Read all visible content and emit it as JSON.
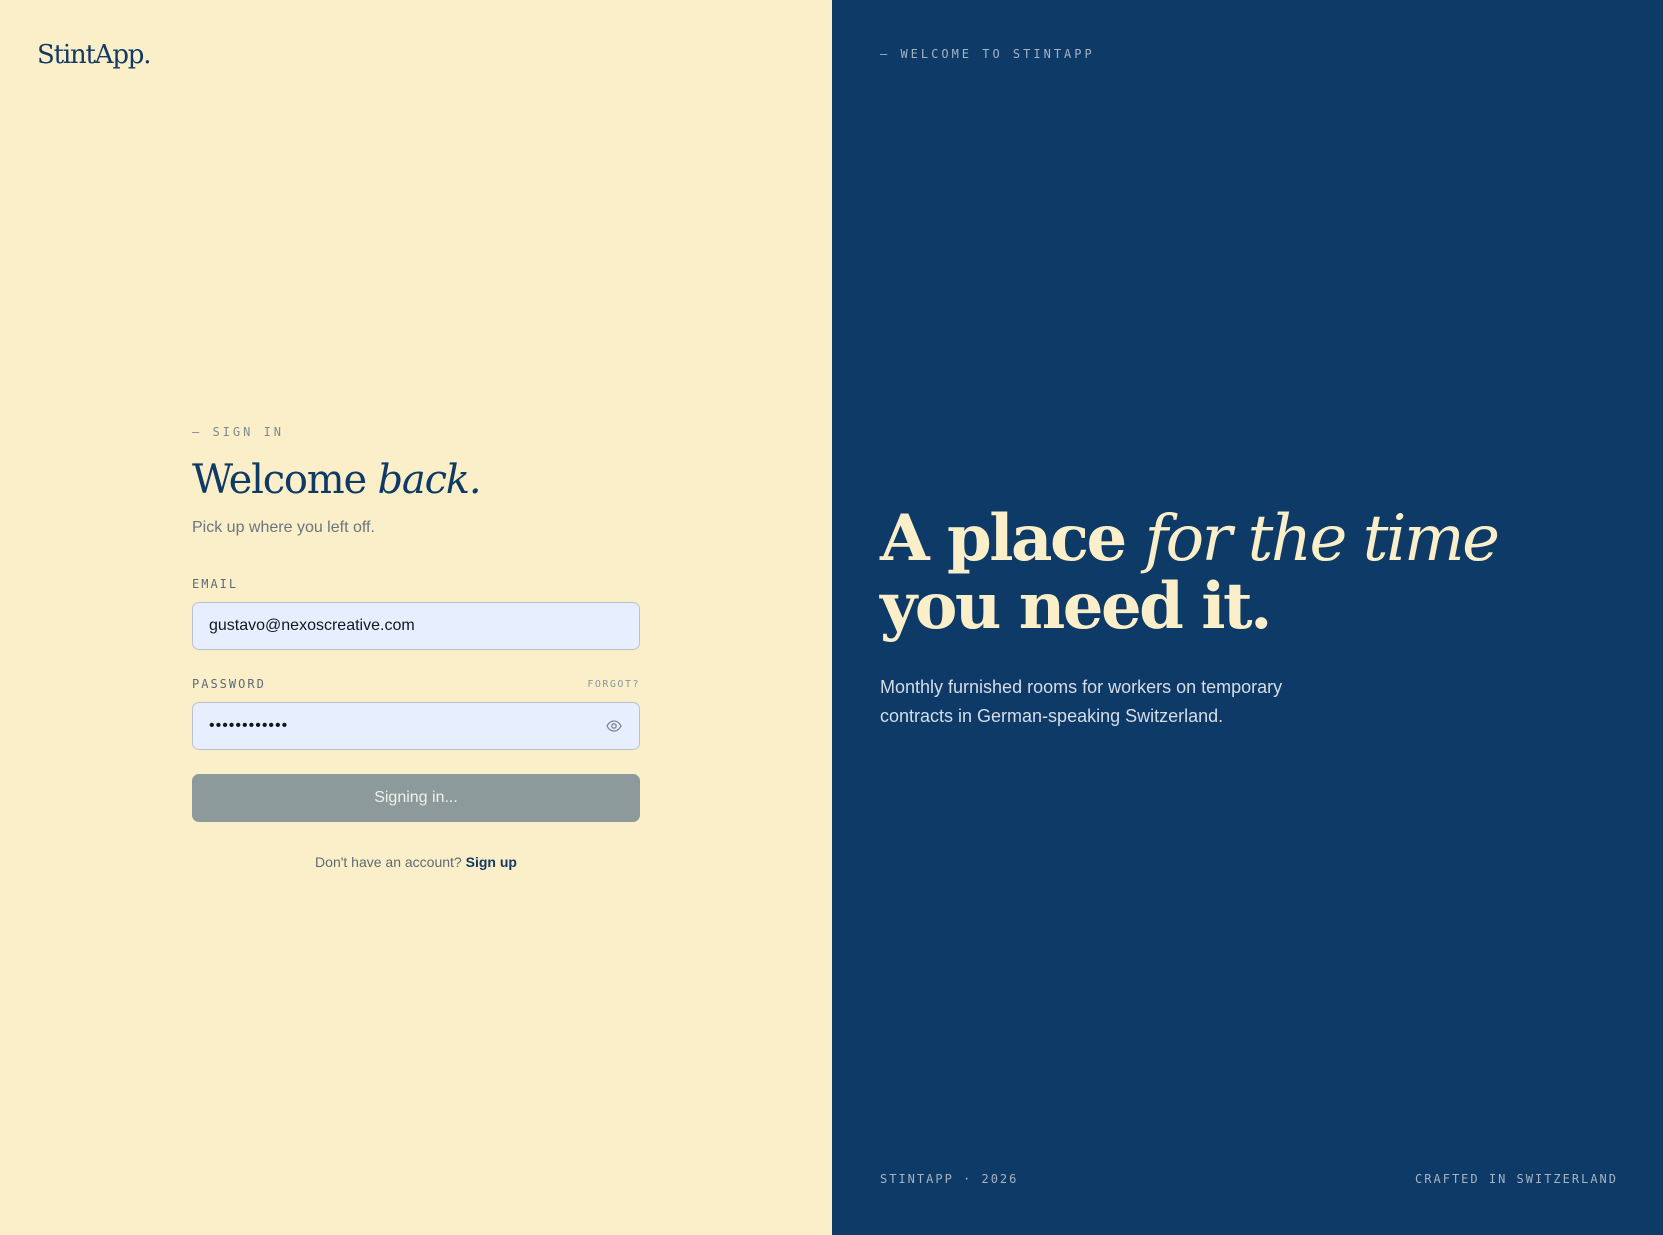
{
  "brand": {
    "logo": "StintApp."
  },
  "signin": {
    "eyebrow": "— SIGN IN",
    "title_plain": "Welcome ",
    "title_italic": "back.",
    "subtitle": "Pick up where you left off.",
    "email_label": "EMAIL",
    "email_value": "gustavo@nexoscreative.com",
    "password_label": "PASSWORD",
    "forgot_label": "FORGOT?",
    "password_masked": "••••••••••••",
    "submit_label": "Signing in...",
    "signup_prompt": "Don't have an account? ",
    "signup_link": "Sign up"
  },
  "hero": {
    "eyebrow": "— WELCOME TO STINTAPP",
    "headline_part1": "A place ",
    "headline_part2": "for the time",
    "headline_part3": "you need it.",
    "description": "Monthly furnished rooms for workers on temporary contracts in German-speaking Switzerland.",
    "footer_left": "STINTAPP · 2026",
    "footer_right": "CRAFTED IN SWITZERLAND"
  },
  "icons": {
    "password_toggle": "eye-icon"
  },
  "colors": {
    "cream": "#faefc8",
    "navy": "#0e3a68",
    "input_bg": "#e7efff",
    "button_disabled": "#8c9a9c"
  }
}
